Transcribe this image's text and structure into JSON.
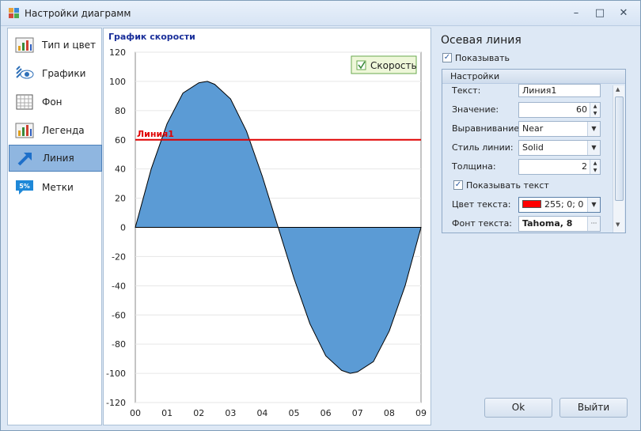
{
  "window": {
    "title": "Настройки диаграмм"
  },
  "sidebar": {
    "items": [
      {
        "label": "Тип и цвет",
        "icon": "bar-chart-icon",
        "active": false
      },
      {
        "label": "Графики",
        "icon": "graphs-eye-icon",
        "active": false
      },
      {
        "label": "Фон",
        "icon": "background-grid-icon",
        "active": false
      },
      {
        "label": "Легенда",
        "icon": "legend-icon",
        "active": false
      },
      {
        "label": "Линия",
        "icon": "line-arrow-icon",
        "active": true
      },
      {
        "label": "Метки",
        "icon": "labels-percent-icon",
        "active": false
      }
    ]
  },
  "chart": {
    "title": "График скорости",
    "legend_label": "Скорость",
    "constant_line_label": "Линия1"
  },
  "chart_data": {
    "type": "area",
    "title": "График скорости",
    "x": [
      "00",
      "01",
      "02",
      "03",
      "04",
      "05",
      "06",
      "07",
      "08",
      "09"
    ],
    "yticks": [
      120,
      100,
      80,
      60,
      40,
      20,
      0,
      -20,
      -40,
      -60,
      -80,
      -100,
      -120
    ],
    "ylim": [
      -120,
      120
    ],
    "xlim": [
      0,
      9
    ],
    "grid": true,
    "legend_position": "top-right",
    "series": [
      {
        "name": "Скорость",
        "color": "#5b9bd5",
        "points": [
          [
            0.0,
            0
          ],
          [
            0.5,
            40
          ],
          [
            1.0,
            71
          ],
          [
            1.5,
            92
          ],
          [
            2.0,
            99
          ],
          [
            2.27,
            100
          ],
          [
            2.5,
            98
          ],
          [
            3.0,
            88
          ],
          [
            3.5,
            66
          ],
          [
            4.0,
            35
          ],
          [
            4.5,
            0
          ],
          [
            5.0,
            -35
          ],
          [
            5.5,
            -66
          ],
          [
            6.0,
            -88
          ],
          [
            6.5,
            -98
          ],
          [
            6.77,
            -100
          ],
          [
            7.0,
            -99
          ],
          [
            7.5,
            -92
          ],
          [
            8.0,
            -71
          ],
          [
            8.5,
            -40
          ],
          [
            9.0,
            0
          ]
        ]
      }
    ],
    "constant_lines": [
      {
        "name": "Линия1",
        "value": 60,
        "color": "#e00000"
      }
    ]
  },
  "props": {
    "title": "Осевая линия",
    "show_label": "Показывать",
    "show_checked": true,
    "group_title": "Настройки",
    "text_label": "Текст:",
    "text_value": "Линия1",
    "value_label": "Значение:",
    "value_value": "60",
    "align_label": "Выравнивание:",
    "align_value": "Near",
    "style_label": "Стиль линии:",
    "style_value": "Solid",
    "thickness_label": "Толщина:",
    "thickness_value": "2",
    "show_text_label": "Показывать текст",
    "show_text_checked": true,
    "text_color_label": "Цвет текста:",
    "text_color_value": "255; 0; 0",
    "text_color_hex": "#ff0000",
    "font_label": "Фонт текста:",
    "font_value": "Tahoma, 8"
  },
  "buttons": {
    "ok": "Ok",
    "exit": "Выйти"
  }
}
